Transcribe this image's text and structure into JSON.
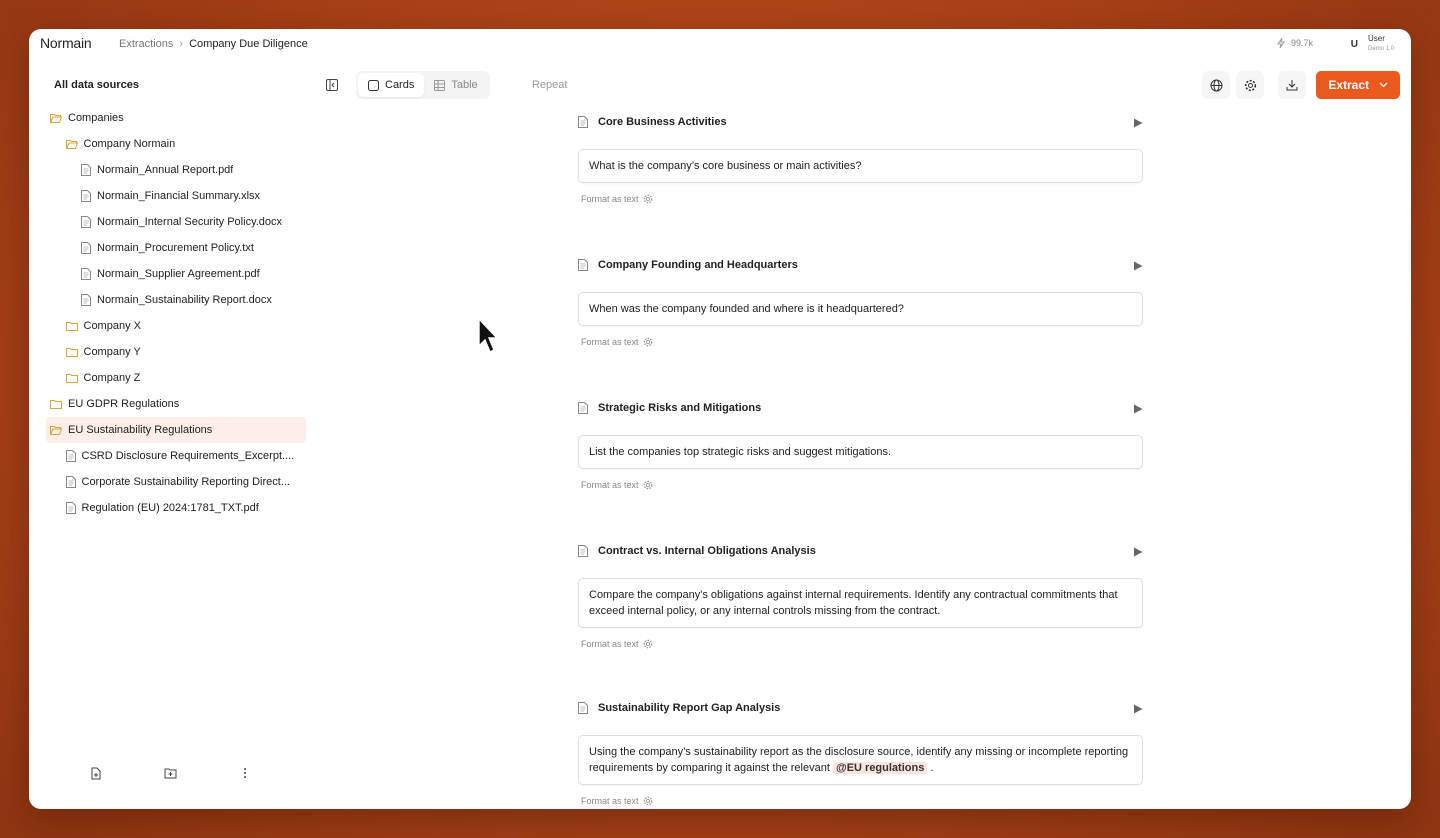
{
  "app": {
    "logo": "Normain"
  },
  "breadcrumb": {
    "parent": "Extractions",
    "separator": "›",
    "current": "Company Due Diligence"
  },
  "header": {
    "credits": "99.7k",
    "avatar_initial": "U",
    "user_name": "User",
    "user_sub": "Demo 1.0"
  },
  "sidebar": {
    "title": "All data sources",
    "tree": [
      {
        "label": "Companies",
        "type": "folder-open",
        "level": 0
      },
      {
        "label": "Company Normain",
        "type": "folder-open",
        "level": 1
      },
      {
        "label": "Normain_Annual Report.pdf",
        "type": "file",
        "level": 2
      },
      {
        "label": "Normain_Financial Summary.xlsx",
        "type": "file",
        "level": 2
      },
      {
        "label": "Normain_Internal Security Policy.docx",
        "type": "file",
        "level": 2
      },
      {
        "label": "Normain_Procurement Policy.txt",
        "type": "file",
        "level": 2
      },
      {
        "label": "Normain_Supplier Agreement.pdf",
        "type": "file",
        "level": 2
      },
      {
        "label": "Normain_Sustainability Report.docx",
        "type": "file",
        "level": 2
      },
      {
        "label": "Company X",
        "type": "folder",
        "level": 1
      },
      {
        "label": "Company Y",
        "type": "folder",
        "level": 1
      },
      {
        "label": "Company Z",
        "type": "folder",
        "level": 1
      },
      {
        "label": "EU GDPR Regulations",
        "type": "folder",
        "level": 0
      },
      {
        "label": "EU Sustainability Regulations",
        "type": "folder-open",
        "level": 0,
        "selected": true
      },
      {
        "label": "CSRD Disclosure Requirements_Excerpt....",
        "type": "file",
        "level": 1
      },
      {
        "label": "Corporate Sustainability Reporting Direct...",
        "type": "file",
        "level": 1
      },
      {
        "label": "Regulation (EU) 2024:1781_TXT.pdf",
        "type": "file",
        "level": 1
      }
    ]
  },
  "toolbar": {
    "cards_label": "Cards",
    "table_label": "Table",
    "repeat_label": "Repeat",
    "extract_label": "Extract"
  },
  "cards": [
    {
      "title": "Core Business Activities",
      "prompt": "What is the company’s core business or main activities?",
      "format": "Format as text"
    },
    {
      "title": "Company Founding and Headquarters",
      "prompt": "When was the company founded and where is it headquartered?",
      "format": "Format as text"
    },
    {
      "title": "Strategic Risks and Mitigations",
      "prompt": "List the companies top strategic risks and suggest mitigations.",
      "format": "Format as text"
    },
    {
      "title": "Contract vs. Internal Obligations Analysis",
      "prompt": "Compare the company's obligations against internal requirements. Identify any contractual commitments that exceed internal policy, or any internal controls missing from the contract.",
      "format": "Format as text"
    },
    {
      "title": "Sustainability Report Gap Analysis",
      "prompt": "Using the company’s sustainability report as the disclosure source, identify any missing or incomplete reporting requirements by comparing it against the relevant",
      "mention": "@EU regulations",
      "prompt_tail": ".",
      "format": "Format as text"
    }
  ],
  "colors": {
    "accent": "#ea5a1e",
    "selected_bg": "#fdeeea",
    "folder": "#e0a23a",
    "background": "#c7531c"
  }
}
